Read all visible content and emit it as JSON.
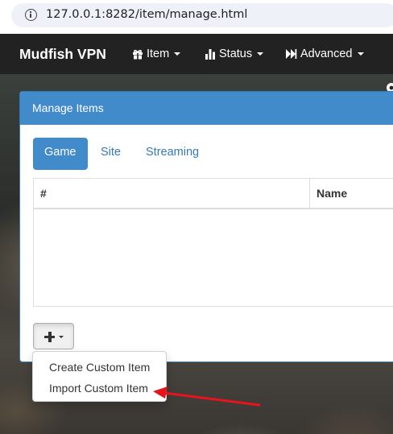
{
  "browser": {
    "url": "127.0.0.1:8282/item/manage.html"
  },
  "navbar": {
    "brand": "Mudfish VPN",
    "items": [
      {
        "label": "Item",
        "icon": "gift-icon"
      },
      {
        "label": "Status",
        "icon": "bar-chart-icon"
      },
      {
        "label": "Advanced",
        "icon": "fast-forward-icon"
      }
    ],
    "settings_icon": "gear-icon"
  },
  "panel": {
    "title": "Manage Items",
    "tabs": [
      {
        "label": "Game",
        "active": true
      },
      {
        "label": "Site",
        "active": false
      },
      {
        "label": "Streaming",
        "active": false
      }
    ],
    "table": {
      "columns": [
        "#",
        "Name"
      ],
      "rows": []
    },
    "add_button_icon": "plus-icon"
  },
  "dropdown": {
    "items": [
      {
        "label": "Create Custom Item"
      },
      {
        "label": "Import Custom Item"
      }
    ]
  },
  "colors": {
    "navbar": "#222222",
    "panel_heading": "#428bca",
    "link": "#337ab7",
    "annotation_arrow": "#e8141c"
  }
}
